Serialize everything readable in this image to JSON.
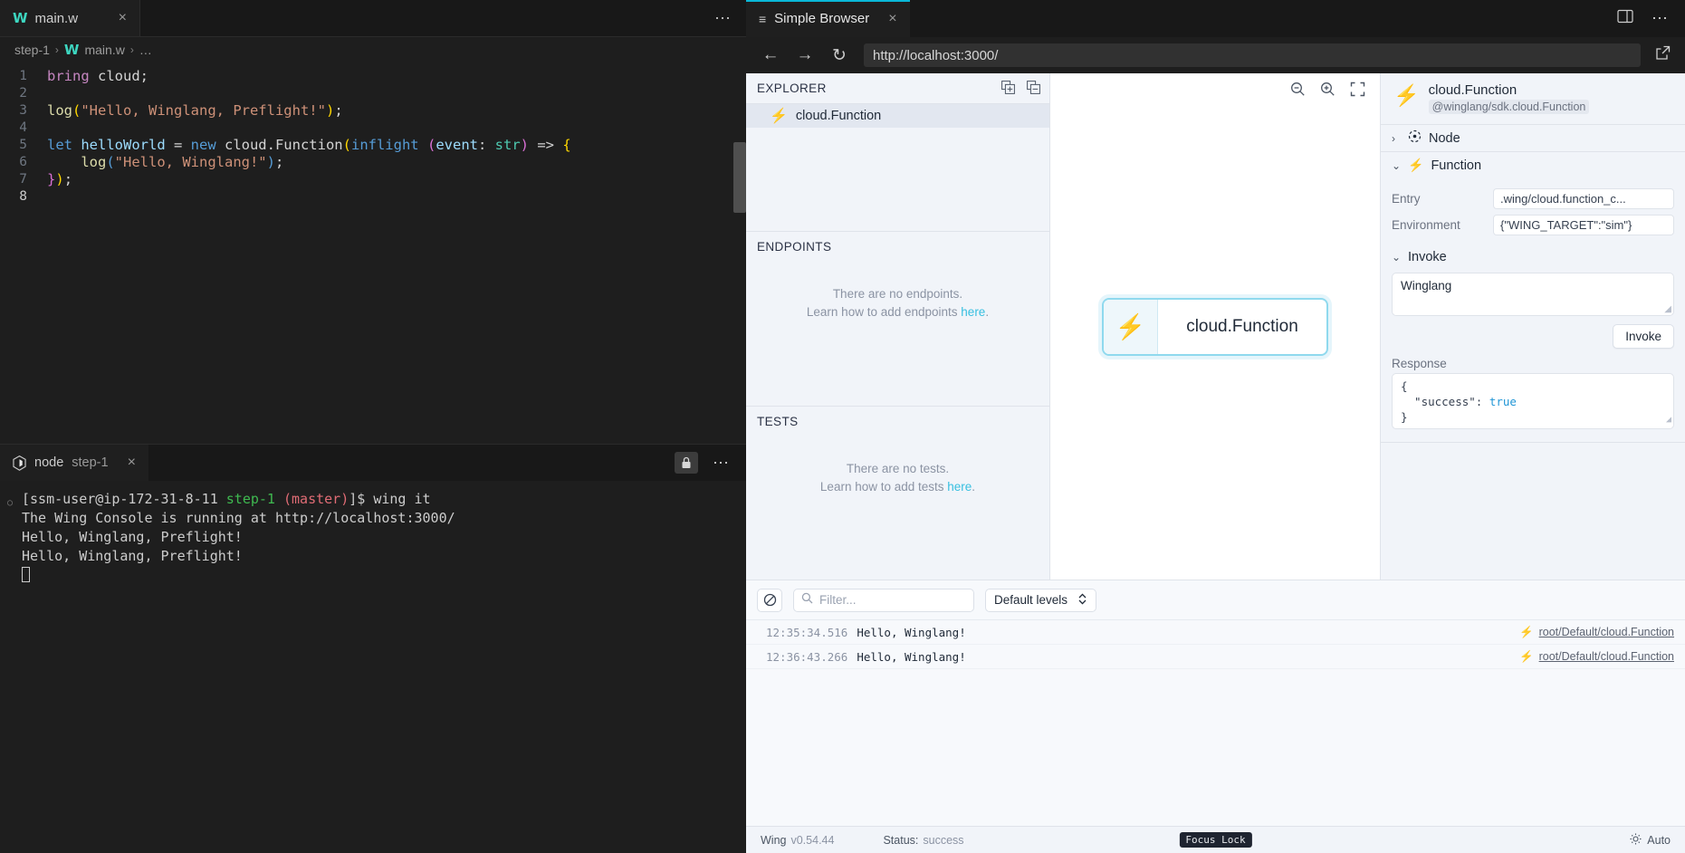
{
  "vscode": {
    "tab": {
      "label": "main.w",
      "icon": "wing-logo-icon",
      "close": "×"
    },
    "tabbar_more": "⋯",
    "breadcrumb": {
      "folder": "step-1",
      "file": "main.w",
      "more": "…",
      "sep": "›"
    },
    "code_lines": [
      {
        "n": "1",
        "tokens": [
          {
            "t": "bring ",
            "c": "t-kw"
          },
          {
            "t": "cloud",
            "c": "t-plain"
          },
          {
            "t": ";",
            "c": "t-punct"
          }
        ]
      },
      {
        "n": "2",
        "tokens": []
      },
      {
        "n": "3",
        "tokens": [
          {
            "t": "log",
            "c": "t-fn"
          },
          {
            "t": "(",
            "c": "t-yellow"
          },
          {
            "t": "\"Hello, Winglang, Preflight!\"",
            "c": "t-str"
          },
          {
            "t": ")",
            "c": "t-yellow"
          },
          {
            "t": ";",
            "c": "t-punct"
          }
        ]
      },
      {
        "n": "4",
        "tokens": []
      },
      {
        "n": "5",
        "tokens": [
          {
            "t": "let ",
            "c": "t-blue"
          },
          {
            "t": "helloWorld",
            "c": "t-id"
          },
          {
            "t": " = ",
            "c": "t-plain"
          },
          {
            "t": "new ",
            "c": "t-blue"
          },
          {
            "t": "cloud.Function",
            "c": "t-plain"
          },
          {
            "t": "(",
            "c": "t-yellow"
          },
          {
            "t": "inflight",
            "c": "t-blue"
          },
          {
            "t": " ",
            "c": "t-plain"
          },
          {
            "t": "(",
            "c": "t-pink"
          },
          {
            "t": "event",
            "c": "t-id"
          },
          {
            "t": ": ",
            "c": "t-plain"
          },
          {
            "t": "str",
            "c": "t-type"
          },
          {
            "t": ")",
            "c": "t-pink"
          },
          {
            "t": " => ",
            "c": "t-plain"
          },
          {
            "t": "{",
            "c": "t-yellow"
          }
        ]
      },
      {
        "n": "6",
        "tokens": [
          {
            "t": "    ",
            "c": "t-plain"
          },
          {
            "t": "log",
            "c": "t-fn"
          },
          {
            "t": "(",
            "c": "t-blue"
          },
          {
            "t": "\"Hello, Winglang!\"",
            "c": "t-str"
          },
          {
            "t": ")",
            "c": "t-blue"
          },
          {
            "t": ";",
            "c": "t-punct"
          }
        ]
      },
      {
        "n": "7",
        "tokens": [
          {
            "t": "}",
            "c": "t-pink"
          },
          {
            "t": ")",
            "c": "t-yellow"
          },
          {
            "t": ";",
            "c": "t-punct"
          }
        ]
      },
      {
        "n": "8",
        "tokens": []
      }
    ],
    "terminal": {
      "tab_label": "node",
      "tab_sublabel": "step-1",
      "tab_close": "×",
      "lock_icon": "lock-icon",
      "more_icon": "⋯",
      "lines": [
        {
          "prompt": true,
          "segs": [
            {
              "t": "[ssm-user@ip-172-31-8-11 ",
              "c": ""
            },
            {
              "t": "step-1",
              "c": "g"
            },
            {
              "t": " ",
              "c": ""
            },
            {
              "t": "(master)",
              "c": "r"
            },
            {
              "t": "]$ wing it",
              "c": ""
            }
          ]
        },
        {
          "prompt": false,
          "segs": [
            {
              "t": "The Wing Console is running at http://localhost:3000/",
              "c": ""
            }
          ]
        },
        {
          "prompt": false,
          "segs": [
            {
              "t": "Hello, Winglang, Preflight!",
              "c": ""
            }
          ]
        },
        {
          "prompt": false,
          "segs": [
            {
              "t": "Hello, Winglang, Preflight!",
              "c": ""
            }
          ]
        }
      ]
    }
  },
  "browser": {
    "tab": {
      "label": "Simple Browser",
      "icon": "browser-tab-icon",
      "close": "×"
    },
    "split_icon": "split-editor-icon",
    "more_icon": "⋯",
    "toolbar": {
      "back": "←",
      "forward": "→",
      "reload": "↻",
      "url": "http://localhost:3000/",
      "open_external": "open-external-icon"
    }
  },
  "console": {
    "explorer": {
      "title": "EXPLORER",
      "expand_icon": "expand-all-icon",
      "collapse_icon": "collapse-all-icon",
      "items": [
        {
          "label": "cloud.Function",
          "icon": "function-bolt-icon"
        }
      ]
    },
    "endpoints": {
      "title": "ENDPOINTS",
      "empty_line1": "There are no endpoints.",
      "empty_line2_pre": "Learn how to add endpoints ",
      "empty_link": "here",
      "empty_line2_post": "."
    },
    "tests": {
      "title": "TESTS",
      "empty_line1": "There are no tests.",
      "empty_line2_pre": "Learn how to add tests ",
      "empty_link": "here",
      "empty_line2_post": "."
    },
    "canvas": {
      "zoom_out_icon": "zoom-out-icon",
      "zoom_in_icon": "zoom-in-icon",
      "fit_icon": "fit-to-screen-icon",
      "node_label": "cloud.Function",
      "node_icon": "function-bolt-icon"
    },
    "detail": {
      "title": "cloud.Function",
      "subtitle": "@winglang/sdk.cloud.Function",
      "icon": "function-bolt-icon",
      "sections": [
        {
          "label": "Node",
          "icon": "node-target-icon",
          "chevron": "›",
          "expanded": false
        },
        {
          "label": "Function",
          "icon": "function-bolt-icon",
          "chevron": "⌄",
          "expanded": true
        }
      ],
      "fields": [
        {
          "key": "Entry",
          "value": ".wing/cloud.function_c..."
        },
        {
          "key": "Environment",
          "value": "{\"WING_TARGET\":\"sim\"}"
        }
      ],
      "invoke": {
        "label": "Invoke",
        "chevron": "⌄",
        "payload": "Winglang",
        "button": "Invoke",
        "response_label": "Response",
        "response_open": "{",
        "response_key": "  \"success\": ",
        "response_value": "true",
        "response_close": "}"
      }
    },
    "logs": {
      "clear_icon": "clear-console-icon",
      "search_icon": "search-icon",
      "filter_placeholder": "Filter...",
      "levels_label": "Default levels",
      "levels_chevron": "⌃⌄",
      "rows": [
        {
          "time": "12:35:34.516",
          "message": "Hello, Winglang!",
          "source": "root/Default/cloud.Function",
          "icon": "function-bolt-icon"
        },
        {
          "time": "12:36:43.266",
          "message": "Hello, Winglang!",
          "source": "root/Default/cloud.Function",
          "icon": "function-bolt-icon"
        }
      ]
    },
    "statusbar": {
      "app": "Wing",
      "version": "v0.54.44",
      "status_label": "Status:",
      "status_value": "success",
      "focus_lock": "Focus Lock",
      "theme_icon": "sun-icon",
      "theme_label": "Auto"
    }
  },
  "colors": {
    "accent": "#23b8e8",
    "tab_accent": "#0ab8d8",
    "link": "#37bfe0",
    "panel_bg": "#f1f4f9",
    "editor_bg": "#1e1e1e"
  }
}
